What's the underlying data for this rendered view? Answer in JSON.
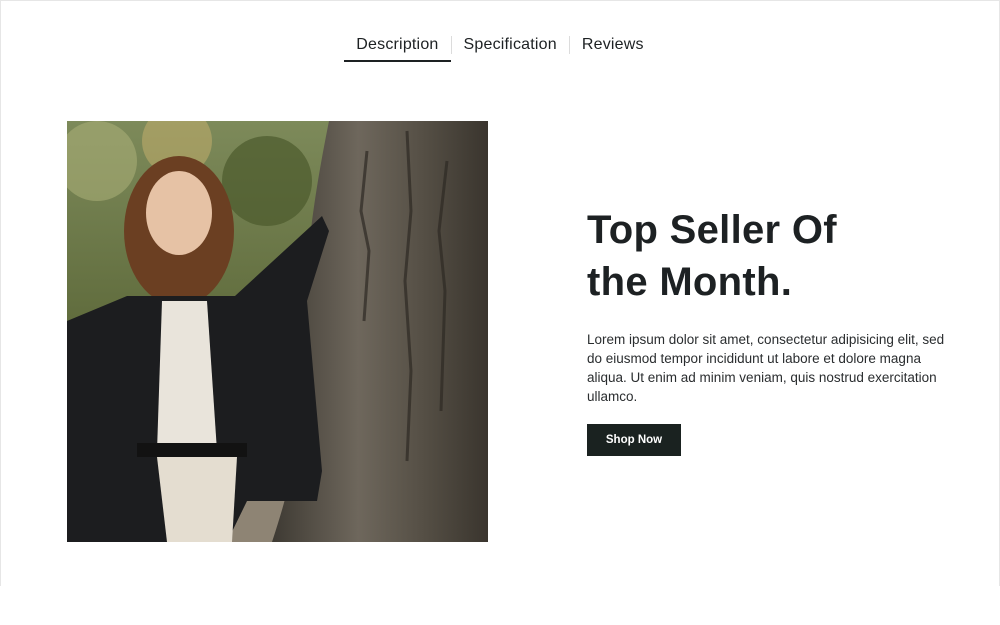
{
  "tabs": [
    {
      "label": "Description",
      "active": true
    },
    {
      "label": "Specification",
      "active": false
    },
    {
      "label": "Reviews",
      "active": false
    }
  ],
  "feature": {
    "headline_line1": "Top Seller Of",
    "headline_line2": "the Month.",
    "description": "Lorem ipsum dolor sit amet, consectetur adipisicing elit, sed do eiusmod tempor incididunt ut labore et dolore magna aliqua. Ut enim ad minim veniam, quis nostrud exercitation ullamco.",
    "cta_label": "Shop Now"
  },
  "colors": {
    "text": "#1d2123",
    "button_bg": "#1a2220",
    "button_text": "#ffffff",
    "background": "#ffffff"
  }
}
